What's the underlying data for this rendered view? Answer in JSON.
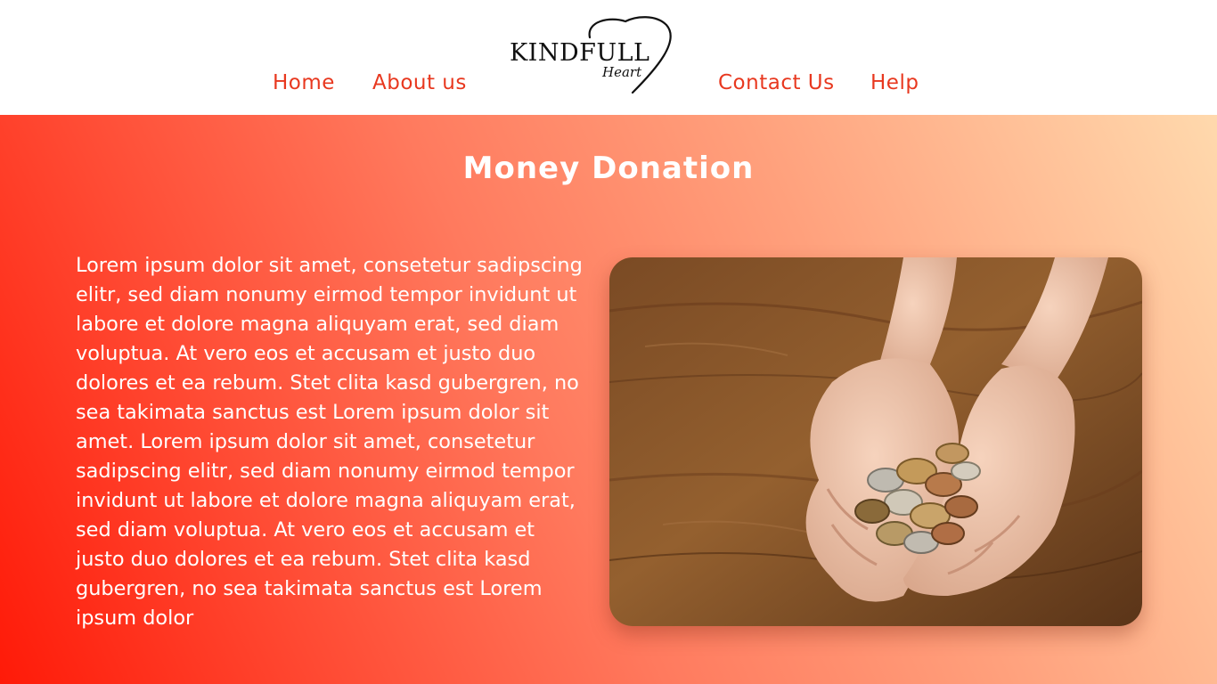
{
  "nav": {
    "home": "Home",
    "about": "About us",
    "contact": "Contact Us",
    "help": "Help"
  },
  "logo": {
    "word": "KINDFULL",
    "sub": "Heart"
  },
  "hero": {
    "title": "Money Donation",
    "body": "Lorem ipsum dolor sit amet, consetetur sadipscing elitr, sed diam nonumy eirmod tempor invidunt ut labore et dolore magna aliquyam erat, sed diam voluptua. At vero eos et accusam et justo duo dolores et ea rebum. Stet clita kasd gubergren, no sea takimata sanctus est Lorem ipsum dolor sit amet. Lorem ipsum dolor sit amet, consetetur sadipscing elitr, sed diam nonumy eirmod tempor invidunt ut labore et dolore magna aliquyam erat, sed diam voluptua. At vero eos et accusam et justo duo dolores et ea rebum. Stet clita kasd gubergren, no sea takimata sanctus est Lorem ipsum dolor",
    "image_icon": "hands-holding-coins-photo"
  },
  "colors": {
    "accent": "#e8381f",
    "gradient_start": "#ff1a08",
    "gradient_end": "#ffd9ad",
    "header_bg": "#ffffff"
  }
}
